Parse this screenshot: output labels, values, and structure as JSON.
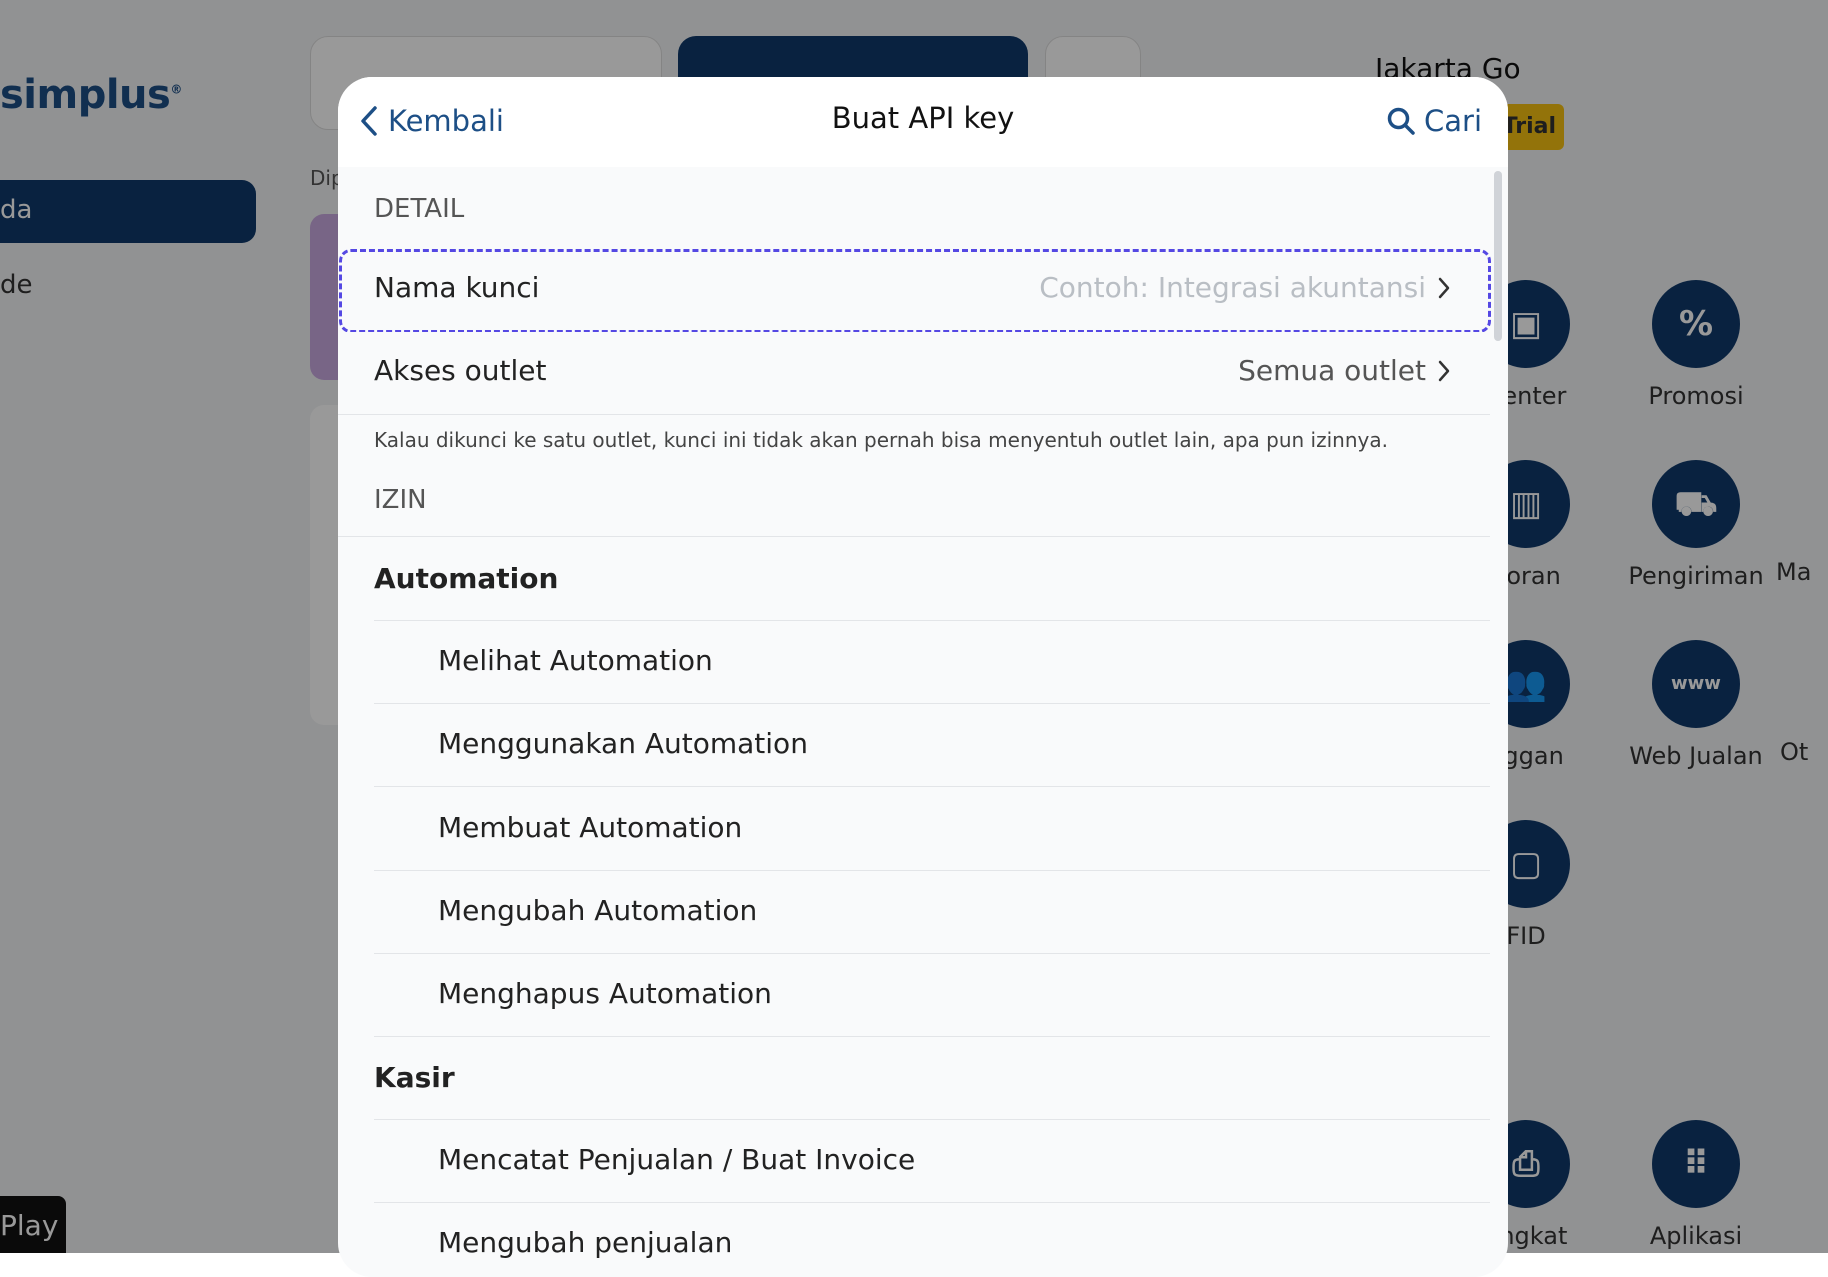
{
  "background": {
    "logo": "simplus",
    "sidebar_active": "da",
    "sidebar_item": "de",
    "dip_text": "Dip",
    "outlet_name": "Jakarta Go",
    "trial_badge": "Trial",
    "features": [
      {
        "label": "Center",
        "icon": "box-icon"
      },
      {
        "label": "Promosi",
        "icon": "percent-icon"
      },
      {
        "label": "poran",
        "icon": "chart-icon"
      },
      {
        "label": "Pengiriman",
        "icon": "truck-icon"
      },
      {
        "label": "Ma",
        "icon": ""
      },
      {
        "label": "nggan",
        "icon": "users-icon"
      },
      {
        "label": "Web Jualan",
        "icon": "www-icon"
      },
      {
        "label": "Ot",
        "icon": ""
      },
      {
        "label": "FID",
        "icon": "rfid-icon"
      },
      {
        "label": "angkat",
        "icon": "printer-icon"
      },
      {
        "label": "Aplikasi",
        "icon": "grid-icon"
      }
    ],
    "play_badge": "Play"
  },
  "modal": {
    "back_label": "Kembali",
    "title": "Buat API key",
    "search_label": "Cari",
    "detail_section": "DETAIL",
    "key_name_label": "Nama kunci",
    "key_name_placeholder": "Contoh: Integrasi akuntansi",
    "outlet_access_label": "Akses outlet",
    "outlet_access_value": "Semua outlet",
    "outlet_note": "Kalau dikunci ke satu outlet, kunci ini tidak akan pernah bisa menyentuh outlet lain, apa pun izinnya.",
    "permission_section": "IZIN",
    "groups": [
      {
        "title": "Automation",
        "items": [
          "Melihat Automation",
          "Menggunakan Automation",
          "Membuat Automation",
          "Mengubah Automation",
          "Menghapus Automation"
        ]
      },
      {
        "title": "Kasir",
        "items": [
          "Mencatat Penjualan / Buat Invoice",
          "Mengubah penjualan"
        ]
      }
    ]
  },
  "colors": {
    "brand": "#0f3a6b",
    "link": "#1d4f86",
    "focus": "#5548e3",
    "trial": "#f6c012"
  }
}
